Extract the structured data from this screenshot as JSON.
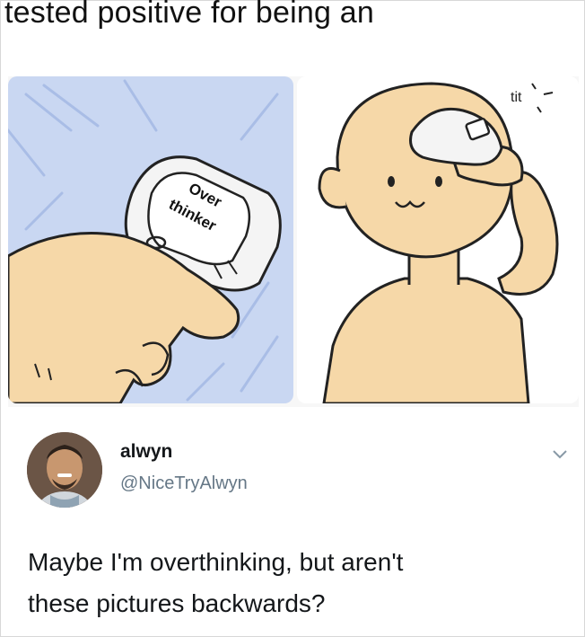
{
  "caption": "tested positive for being an",
  "comic": {
    "thermometer_label_line1": "Over",
    "thermometer_label_line2": "thinker",
    "sound_effect": "tit"
  },
  "tweet": {
    "display_name": "alwyn",
    "handle": "@NiceTryAlwyn",
    "text_line1": "Maybe I'm overthinking, but aren't",
    "text_line2": "these pictures backwards?"
  },
  "icons": {
    "avatar": "profile-photo",
    "more": "chevron-down-icon"
  },
  "colors": {
    "panel_sky": "#c9d7f2",
    "skin": "#f6d8a8",
    "handle": "#657786",
    "text": "#14171a"
  }
}
